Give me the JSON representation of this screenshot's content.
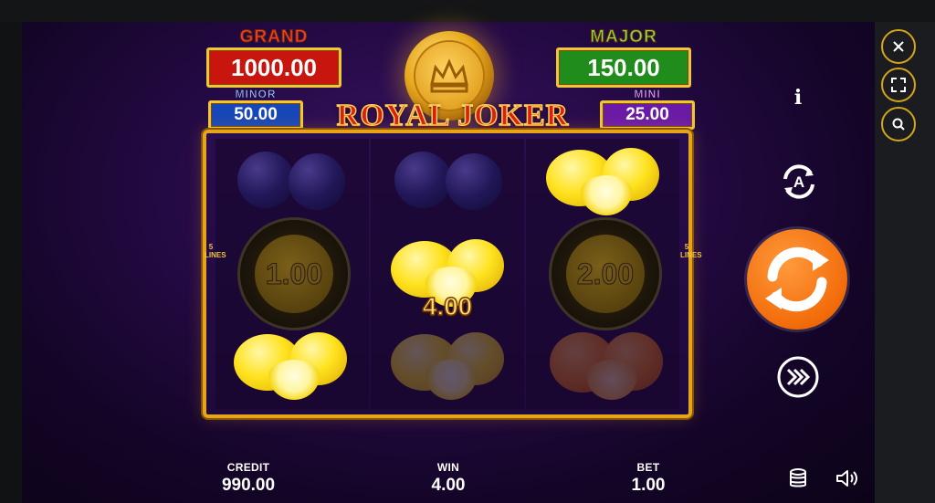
{
  "jackpots": {
    "grand": {
      "title": "GRAND",
      "value": "1000.00"
    },
    "major": {
      "title": "MAJOR",
      "value": "150.00"
    },
    "minor": {
      "title": "MINOR",
      "value": "50.00"
    },
    "mini": {
      "title": "MINI",
      "value": "25.00"
    }
  },
  "logo": {
    "text": "ROYAL JOKER"
  },
  "reels": {
    "lines_label": "5 LINES",
    "col1": [
      "plum",
      "coin",
      "lemon"
    ],
    "col2": [
      "plum",
      "lemon",
      "lemon"
    ],
    "col3": [
      "lemon",
      "coin",
      "orange"
    ],
    "coin_values": {
      "left": "1.00",
      "right": "2.00"
    },
    "win_amount": "4.00"
  },
  "controls": {
    "info_icon": "i",
    "autoplay_icon": "autoplay-icon",
    "spin_icon": "spin-icon",
    "turbo_icon": "fast-forward-icon"
  },
  "bottom": {
    "credit_label": "CREDIT",
    "credit_value": "990.00",
    "win_label": "WIN",
    "win_value": "4.00",
    "bet_label": "BET",
    "bet_value": "1.00"
  },
  "colors": {
    "grand": "#c8150d",
    "major": "#1f8c1c",
    "minor": "#1746b8",
    "mini": "#6a1aa6",
    "spin": "#f26b0a",
    "accent": "#d6a419"
  }
}
